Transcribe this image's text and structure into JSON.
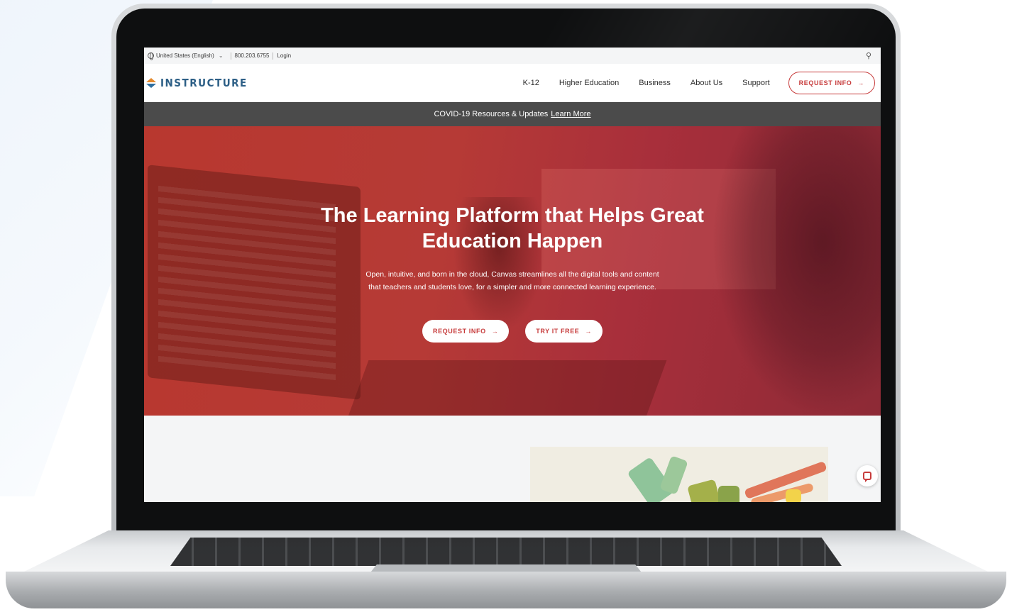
{
  "utility_bar": {
    "region_label": "United States (English)",
    "phone": "800.203.6755",
    "login": "Login"
  },
  "brand": {
    "name": "INSTRUCTURE",
    "colors": {
      "accent_red": "#c73b3b",
      "logo_blue": "#2d5f86",
      "logo_orange": "#e48a2e"
    }
  },
  "nav": {
    "items": [
      "K-12",
      "Higher Education",
      "Business",
      "About Us",
      "Support"
    ],
    "cta_label": "REQUEST INFO"
  },
  "banner": {
    "text": "COVID-19 Resources & Updates",
    "link": "Learn More"
  },
  "hero": {
    "title": "The Learning Platform that Helps Great Education Happen",
    "subtitle": "Open, intuitive, and born in the cloud, Canvas streamlines all the digital tools and content that teachers and students love, for a simpler and more connected learning experience.",
    "primary_button": "REQUEST INFO",
    "secondary_button": "TRY IT FREE"
  },
  "icons": {
    "globe": "globe-icon",
    "chevron": "chevron-down-icon",
    "search": "search-icon",
    "arrow": "arrow-right-icon",
    "chat": "chat-icon"
  },
  "glyphs": {
    "chevron": "⌄",
    "search": "⚲",
    "arrow": "→"
  }
}
